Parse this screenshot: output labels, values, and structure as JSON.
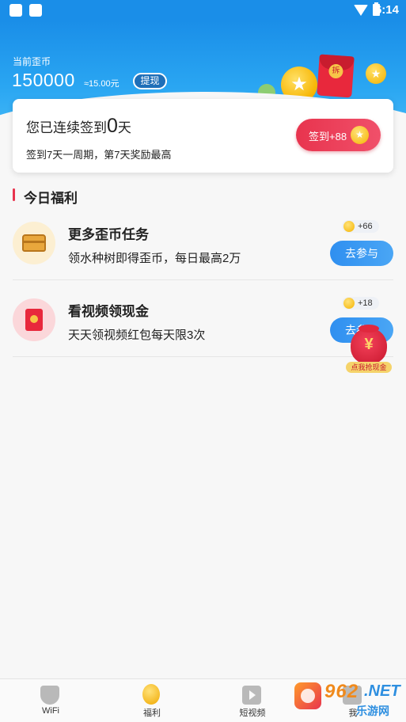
{
  "status_bar": {
    "time": "6:14"
  },
  "header": {
    "balance_label": "当前歪币",
    "balance_value": "150000",
    "balance_approx": "≈15.00元",
    "withdraw_label": "提现",
    "coin_symbol": "★",
    "envelope_symbol": "拆"
  },
  "sign_card": {
    "title_prefix": "您已连续签到",
    "days": "0",
    "title_suffix": "天",
    "subtitle": "签到7天一周期，第7天奖励最高",
    "button_label": "签到+88",
    "button_coin_symbol": "★"
  },
  "section": {
    "title": "今日福利"
  },
  "tasks": [
    {
      "name": "更多歪币任务",
      "desc": "领水种树即得歪币，每日最高2万",
      "reward": "+66",
      "button": "去参与"
    },
    {
      "name": "看视频领现金",
      "desc": "天天领视频红包每天限3次",
      "reward": "+18",
      "button": "去参与"
    }
  ],
  "floating_bag": {
    "symbol": "¥",
    "label": "点我抢现金"
  },
  "bottom_nav": [
    {
      "label": "WiFi"
    },
    {
      "label": "福利"
    },
    {
      "label": "短视频"
    },
    {
      "label": "我"
    }
  ],
  "watermark": {
    "number": "962",
    "domain": ".NET",
    "sub": "乐游网"
  }
}
